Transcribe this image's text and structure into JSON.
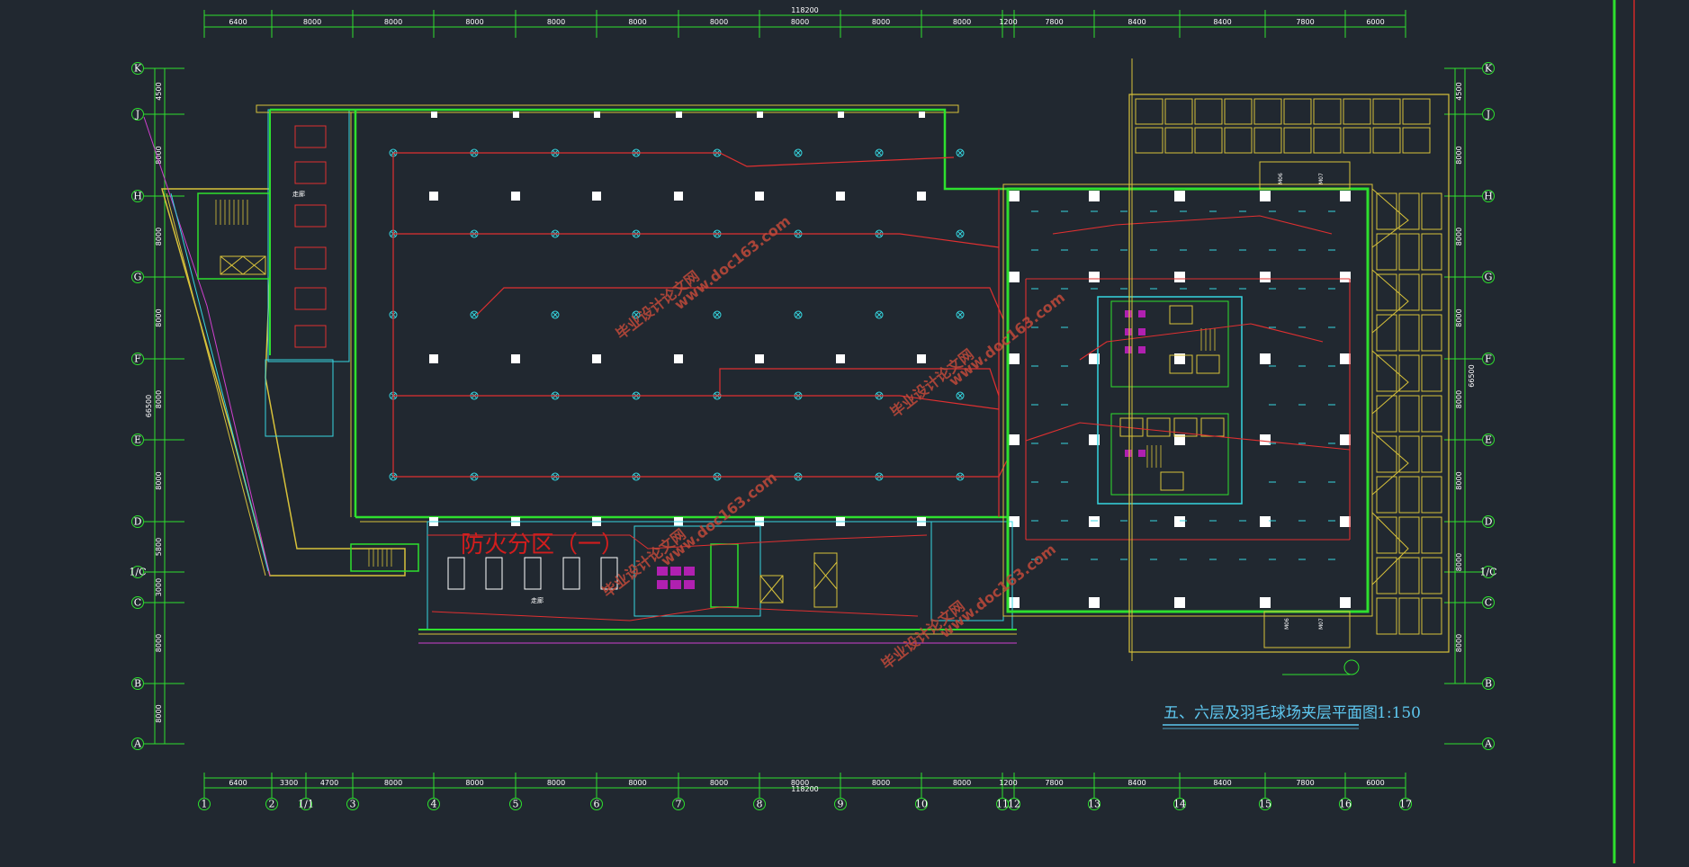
{
  "drawing": {
    "title": "五、六层及羽毛球场夹层平面图",
    "scale": "1:150",
    "fire_zone_label": "防火分区（一）",
    "watermarks": [
      {
        "text": "毕业设计论文网"
      },
      {
        "text": "www.doc163.com"
      },
      {
        "text": "毕业设计论文网"
      },
      {
        "text": "www.doc163.com"
      },
      {
        "text": "毕业设计论文网"
      },
      {
        "text": "www.doc163.com"
      },
      {
        "text": "毕业设计论文网"
      },
      {
        "text": "www.doc163.com"
      }
    ]
  },
  "grid": {
    "columns": [
      "1",
      "2",
      "1/1",
      "3",
      "4",
      "5",
      "6",
      "7",
      "8",
      "9",
      "10",
      "11",
      "12",
      "13",
      "14",
      "15",
      "16",
      "17"
    ],
    "rows": [
      "K",
      "J",
      "H",
      "G",
      "F",
      "E",
      "D",
      "1/C",
      "C",
      "B",
      "A"
    ],
    "top_dims": [
      "6400",
      "8000",
      "8000",
      "8000",
      "8000",
      "8000",
      "8000",
      "8000",
      "8000",
      "8000",
      "1200",
      "7800",
      "8400",
      "8400",
      "7800",
      "6000"
    ],
    "top_total": "118200",
    "bottom_dims": [
      "6400",
      "3300",
      "4700",
      "8000",
      "8000",
      "8000",
      "8000",
      "8000",
      "8000",
      "8000",
      "8000",
      "1200",
      "7800",
      "8400",
      "8400",
      "7800",
      "6000"
    ],
    "bottom_total": "118200",
    "left_dims": [
      "4500",
      "8000",
      "8000",
      "8000",
      "8000",
      "8000",
      "5800",
      "3000",
      "8000",
      "8000"
    ],
    "left_total": "66500",
    "right_dims": [
      "4500",
      "8000",
      "8000",
      "8000",
      "8000",
      "8000",
      "8000",
      "8000"
    ],
    "right_total": "66500"
  },
  "labels": {
    "door_m06_top": "M06",
    "door_m07_top": "M07",
    "door_m06_bottom": "M06",
    "door_m07_bottom": "M07",
    "room_note_1": "走廊",
    "room_note_2": "走廊"
  },
  "colors": {
    "background": "#212830",
    "grid_green": "#2ee02e",
    "wall_yellow": "#d8c23a",
    "circuit_red": "#e03030",
    "cyan": "#36d6e0",
    "magenta": "#d040d0",
    "white": "#ffffff"
  }
}
